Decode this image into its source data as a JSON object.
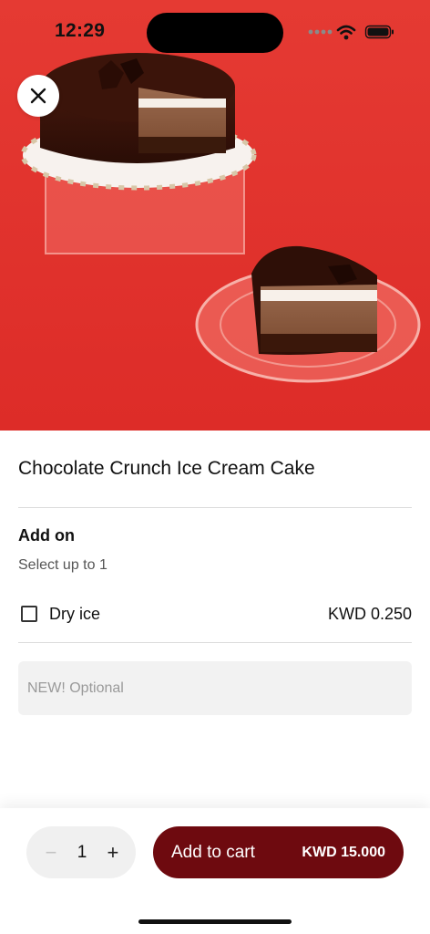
{
  "status_bar": {
    "time": "12:29"
  },
  "product": {
    "title": "Chocolate Crunch Ice Cream Cake"
  },
  "addon": {
    "title": "Add on",
    "subtitle": "Select up to 1",
    "options": [
      {
        "label": "Dry ice",
        "price": "KWD 0.250",
        "checked": false
      }
    ]
  },
  "note": {
    "placeholder": "NEW! Optional",
    "value": ""
  },
  "cart": {
    "quantity": "1",
    "minus_symbol": "−",
    "plus_symbol": "+",
    "add_label": "Add to cart",
    "total": "KWD 15.000"
  },
  "colors": {
    "hero_background": "#e8342e",
    "cart_button": "#6e0a0f",
    "note_field": "#f2f2f2"
  },
  "icons": {
    "close": "close-icon",
    "signal": "cellular-signal-icon",
    "wifi": "wifi-icon",
    "battery": "battery-icon"
  }
}
